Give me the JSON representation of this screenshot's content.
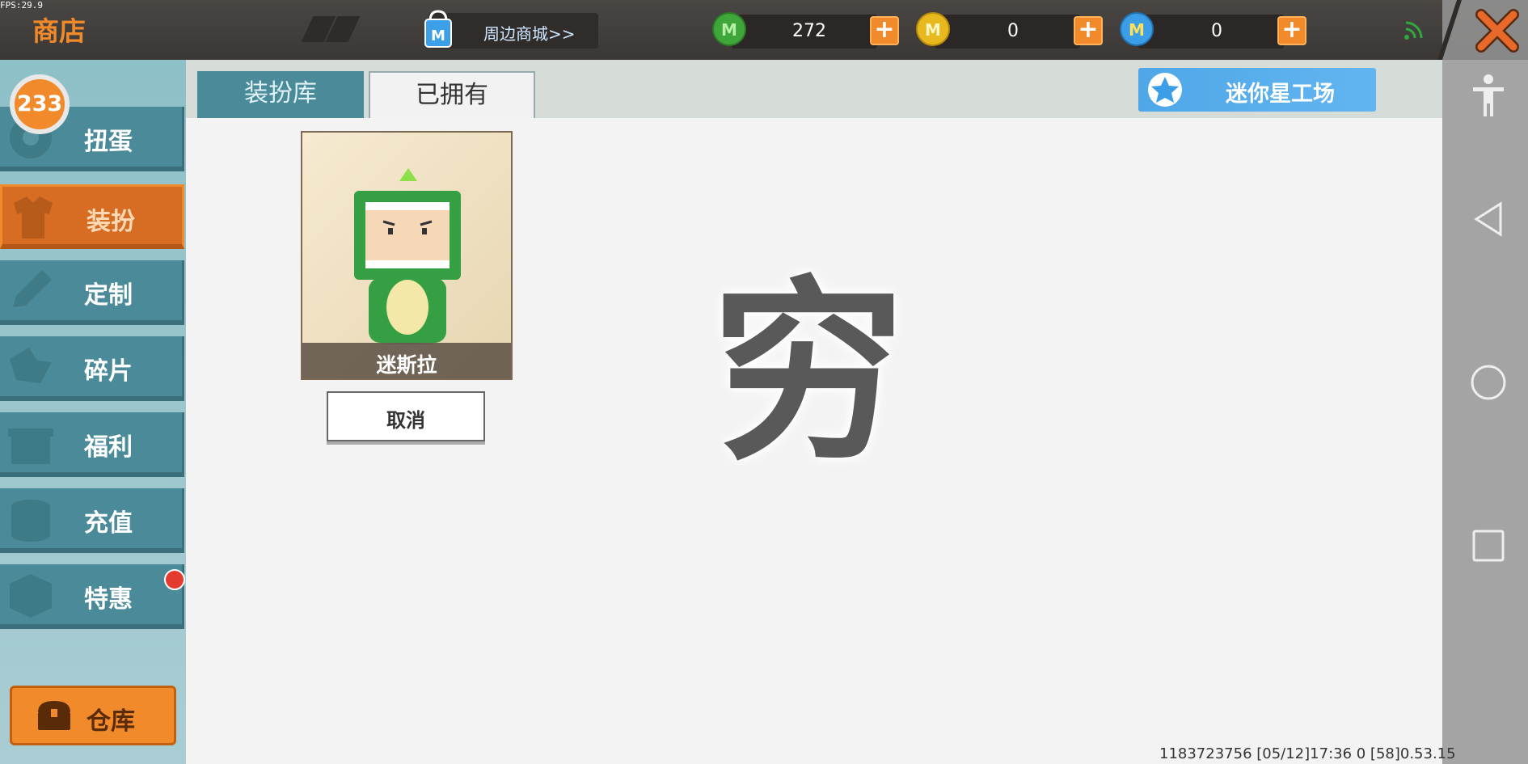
{
  "fps": "FPS:29.9",
  "header": {
    "title": "商店",
    "mall_link": "周边商城>>",
    "currencies": [
      {
        "name": "mini-bean",
        "value": "272",
        "color": "#3fa63a"
      },
      {
        "name": "gold-coin",
        "value": "0",
        "color": "#e8b81f"
      },
      {
        "name": "mini-coin",
        "value": "0",
        "color": "#3c9ee6"
      }
    ],
    "plus_label": "+"
  },
  "sidebar": {
    "badge": "233",
    "items": [
      {
        "label": "扭蛋"
      },
      {
        "label": "装扮"
      },
      {
        "label": "定制"
      },
      {
        "label": "碎片"
      },
      {
        "label": "福利"
      },
      {
        "label": "充值"
      },
      {
        "label": "特惠"
      }
    ],
    "active_index": 1,
    "warehouse_label": "仓库"
  },
  "tabs": [
    {
      "label": "装扮库"
    },
    {
      "label": "已拥有"
    }
  ],
  "active_tab": 1,
  "workshop_label": "迷你星工场",
  "owned_item": {
    "name": "迷斯拉",
    "cancel_label": "取消"
  },
  "overlay_char": "穷",
  "footer": "1183723756   [05/12]17:36 0   [58]0.53.15"
}
